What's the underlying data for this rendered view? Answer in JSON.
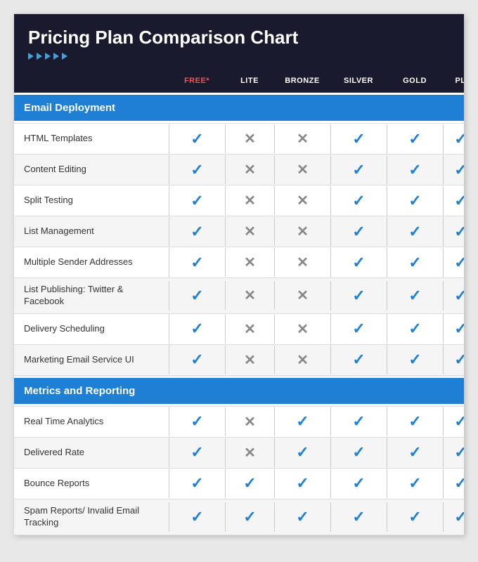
{
  "header": {
    "title": "Pricing Plan Comparison Chart"
  },
  "columns": [
    "",
    "FREE",
    "LITE",
    "BRONZE",
    "SILVER",
    "GOLD",
    "PL"
  ],
  "sections": [
    {
      "name": "Email Deployment",
      "rows": [
        {
          "label": "HTML Templates",
          "values": [
            "check",
            "cross",
            "cross",
            "check",
            "check",
            "check"
          ]
        },
        {
          "label": "Content Editing",
          "values": [
            "check",
            "cross",
            "cross",
            "check",
            "check",
            "check"
          ]
        },
        {
          "label": "Split Testing",
          "values": [
            "check",
            "cross",
            "cross",
            "check",
            "check",
            "check"
          ]
        },
        {
          "label": "List Management",
          "values": [
            "check",
            "cross",
            "cross",
            "check",
            "check",
            "check"
          ]
        },
        {
          "label": "Multiple Sender Addresses",
          "values": [
            "check",
            "cross",
            "cross",
            "check",
            "check",
            "check"
          ]
        },
        {
          "label": "List Publishing: Twitter & Facebook",
          "values": [
            "check",
            "cross",
            "cross",
            "check",
            "check",
            "check"
          ]
        },
        {
          "label": "Delivery Scheduling",
          "values": [
            "check",
            "cross",
            "cross",
            "check",
            "check",
            "check"
          ]
        },
        {
          "label": "Marketing Email Service UI",
          "values": [
            "check",
            "cross",
            "cross",
            "check",
            "check",
            "check"
          ]
        }
      ]
    },
    {
      "name": "Metrics and Reporting",
      "rows": [
        {
          "label": "Real Time Analytics",
          "values": [
            "check",
            "cross",
            "check",
            "check",
            "check",
            "check"
          ]
        },
        {
          "label": "Delivered Rate",
          "values": [
            "check",
            "cross",
            "check",
            "check",
            "check",
            "check"
          ]
        },
        {
          "label": "Bounce Reports",
          "values": [
            "check",
            "check",
            "check",
            "check",
            "check",
            "check"
          ]
        },
        {
          "label": "Spam Reports/ Invalid Email Tracking",
          "values": [
            "check",
            "check",
            "check",
            "check",
            "check",
            "check"
          ]
        }
      ]
    }
  ]
}
